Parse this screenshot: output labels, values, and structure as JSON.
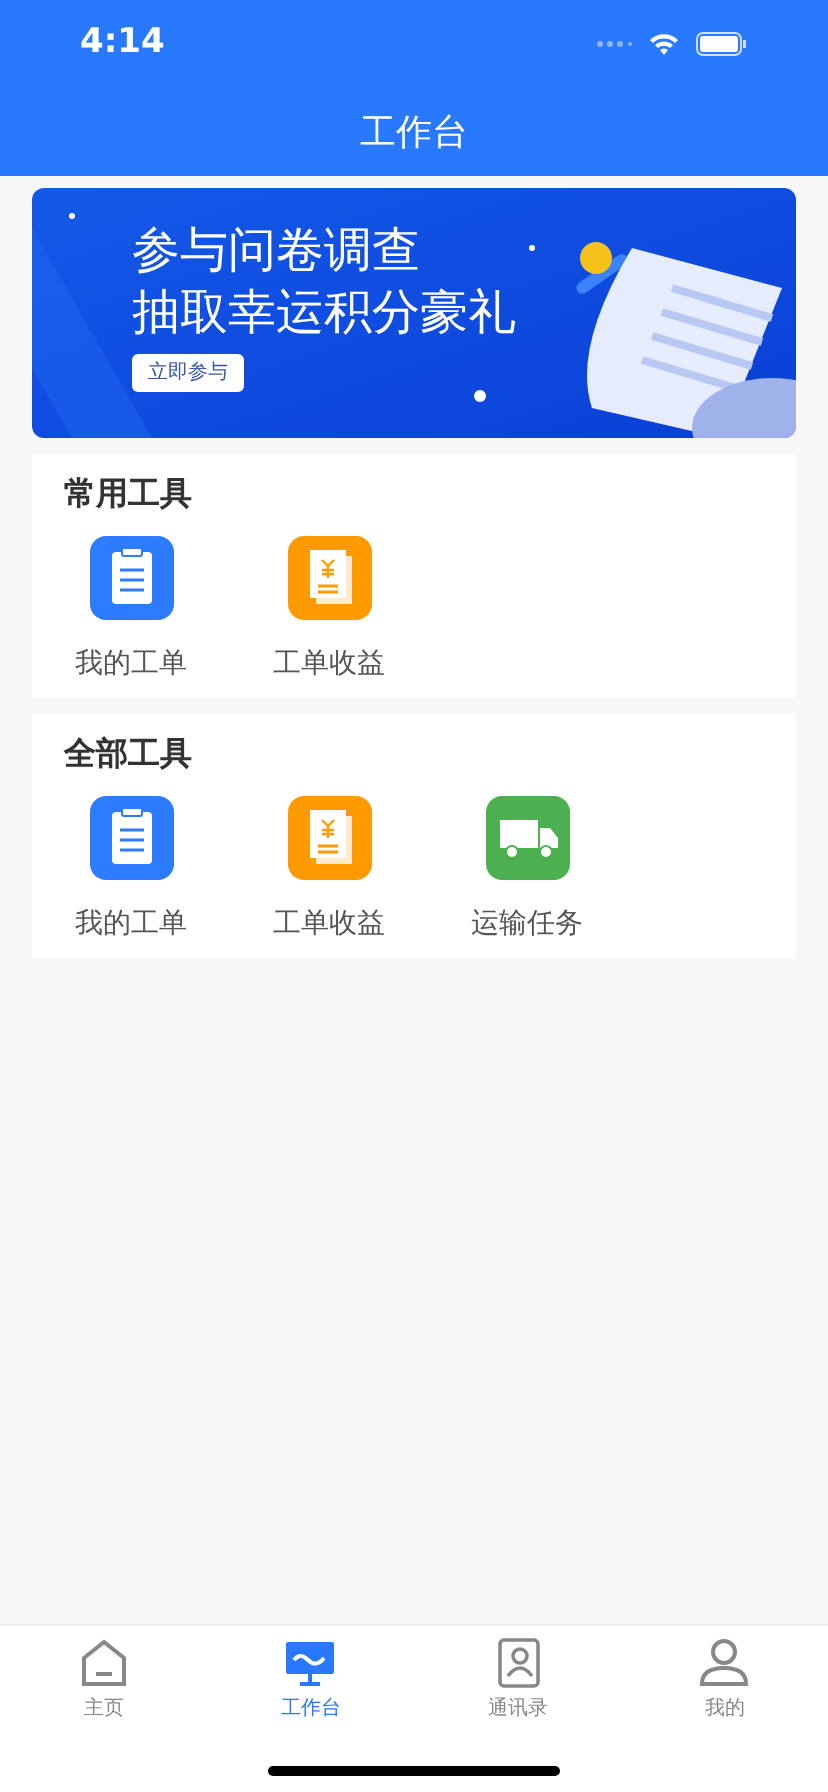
{
  "status_bar": {
    "time": "4:14"
  },
  "header": {
    "title": "工作台"
  },
  "banner": {
    "lines": [
      "参与问卷调查",
      "抽取幸运积分豪礼"
    ],
    "button": "立即参与"
  },
  "sections": [
    {
      "title": "常用工具",
      "tools": [
        {
          "label": "我的工单",
          "kind": "clipboard",
          "color": "#2d7bff"
        },
        {
          "label": "工单收益",
          "kind": "income",
          "color": "#ff9a00"
        }
      ]
    },
    {
      "title": "全部工具",
      "tools": [
        {
          "label": "我的工单",
          "kind": "clipboard",
          "color": "#2d7bff"
        },
        {
          "label": "工单收益",
          "kind": "income",
          "color": "#ff9a00"
        },
        {
          "label": "运输任务",
          "kind": "truck",
          "color": "#4caf50"
        }
      ]
    }
  ],
  "tab_bar": [
    {
      "label": "主页",
      "kind": "home",
      "selected": false
    },
    {
      "label": "工作台",
      "kind": "workbench",
      "selected": true
    },
    {
      "label": "通讯录",
      "kind": "contacts",
      "selected": false
    },
    {
      "label": "我的",
      "kind": "profile",
      "selected": false
    }
  ]
}
